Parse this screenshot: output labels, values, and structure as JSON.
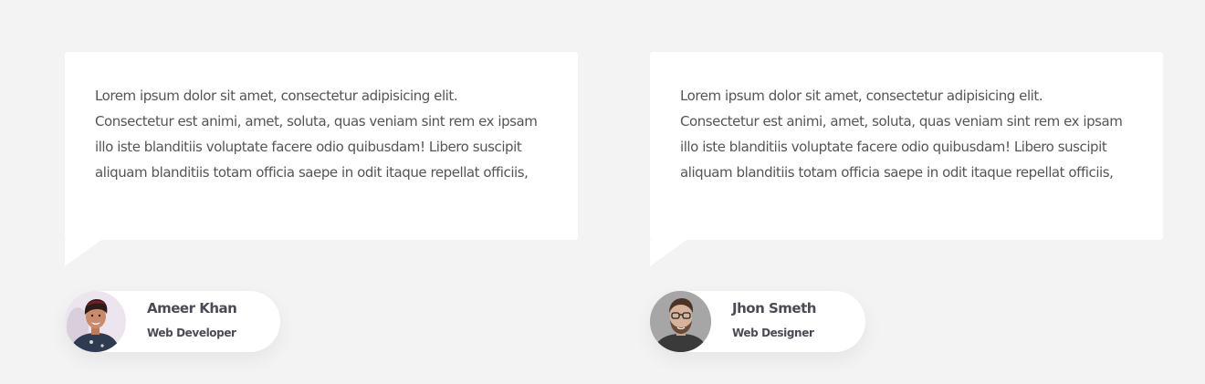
{
  "testimonials": [
    {
      "quote_lines": [
        "Lorem ipsum dolor sit amet, consectetur adipisicing elit.",
        "Consectetur est animi, amet, soluta, quas veniam sint rem ex ipsam",
        "illo iste blanditiis voluptate facere odio quibusdam! Libero suscipit",
        "aliquam blanditiis totam officia saepe in odit itaque repellat officiis,"
      ],
      "author_name": "Ameer Khan",
      "author_role": "Web Developer",
      "avatar": "young-man-with-beanie-photo"
    },
    {
      "quote_lines": [
        "Lorem ipsum dolor sit amet, consectetur adipisicing elit.",
        "Consectetur est animi, amet, soluta, quas veniam sint rem ex ipsam",
        "illo iste blanditiis voluptate facere odio quibusdam! Libero suscipit",
        "aliquam blanditiis totam officia saepe in odit itaque repellat officiis,"
      ],
      "author_name": "Jhon Smeth",
      "author_role": "Web Designer",
      "avatar": "bearded-man-with-glasses-photo"
    }
  ],
  "colors": {
    "background": "#f3f3f3",
    "card": "#ffffff",
    "body_text": "#555555",
    "heading_text": "#4b4b55"
  }
}
